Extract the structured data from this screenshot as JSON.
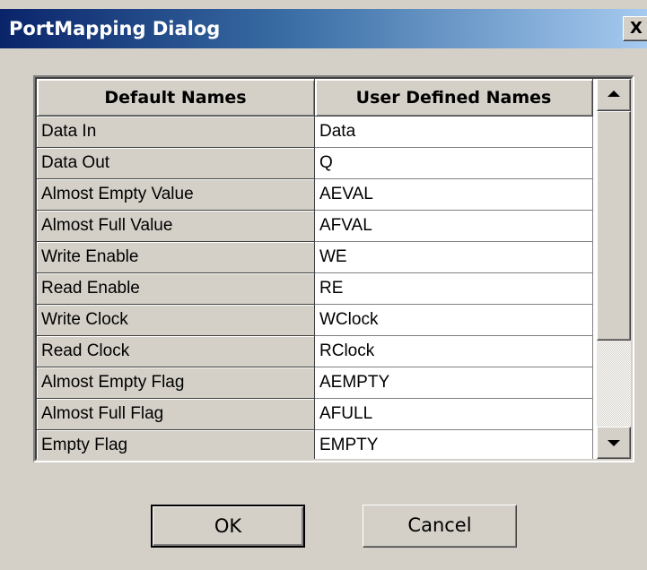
{
  "window": {
    "title": "PortMapping Dialog",
    "close_label": "X"
  },
  "grid": {
    "columns": [
      "Default Names",
      "User Defined Names"
    ],
    "rows": [
      {
        "default": "Data In",
        "user": "Data"
      },
      {
        "default": "Data Out",
        "user": "Q"
      },
      {
        "default": "Almost Empty Value",
        "user": "AEVAL"
      },
      {
        "default": "Almost Full Value",
        "user": "AFVAL"
      },
      {
        "default": "Write Enable",
        "user": "WE"
      },
      {
        "default": "Read Enable",
        "user": "RE"
      },
      {
        "default": "Write Clock",
        "user": "WClock"
      },
      {
        "default": "Read Clock",
        "user": "RClock"
      },
      {
        "default": "Almost Empty Flag",
        "user": "AEMPTY"
      },
      {
        "default": "Almost Full Flag",
        "user": "AFULL"
      },
      {
        "default": "Empty Flag",
        "user": "EMPTY"
      }
    ]
  },
  "buttons": {
    "ok": "OK",
    "cancel": "Cancel"
  },
  "icons": {
    "close": "close-icon",
    "scroll_up": "arrow-up-icon",
    "scroll_down": "arrow-down-icon"
  },
  "colors": {
    "face": "#d4d0c8",
    "title_start": "#0a246a",
    "title_end": "#a6caf0"
  }
}
